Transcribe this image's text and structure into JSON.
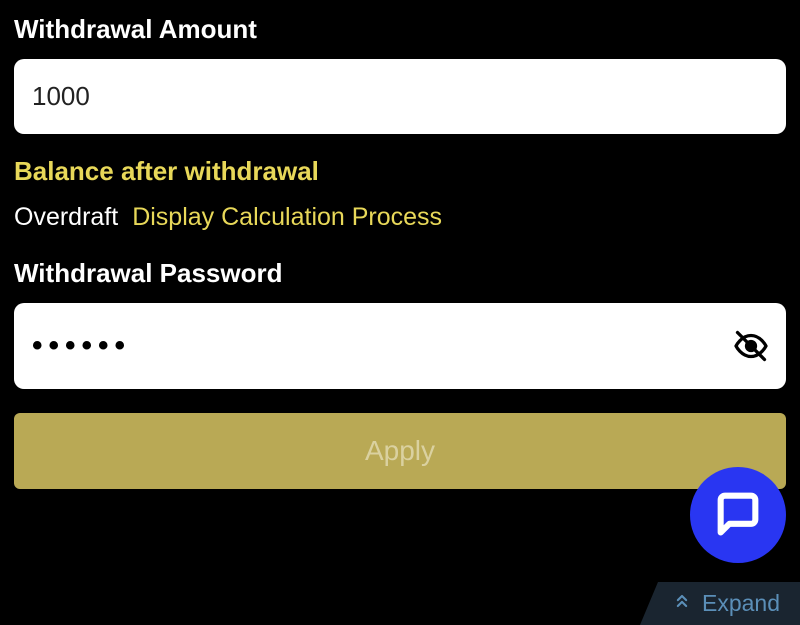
{
  "amount": {
    "label": "Withdrawal Amount",
    "value": "1000"
  },
  "balance": {
    "label": "Balance after withdrawal",
    "overdraft": "Overdraft",
    "calc_link": "Display Calculation Process"
  },
  "password": {
    "label": "Withdrawal Password",
    "masked": "••••••"
  },
  "apply_label": "Apply",
  "expand_label": "Expand"
}
